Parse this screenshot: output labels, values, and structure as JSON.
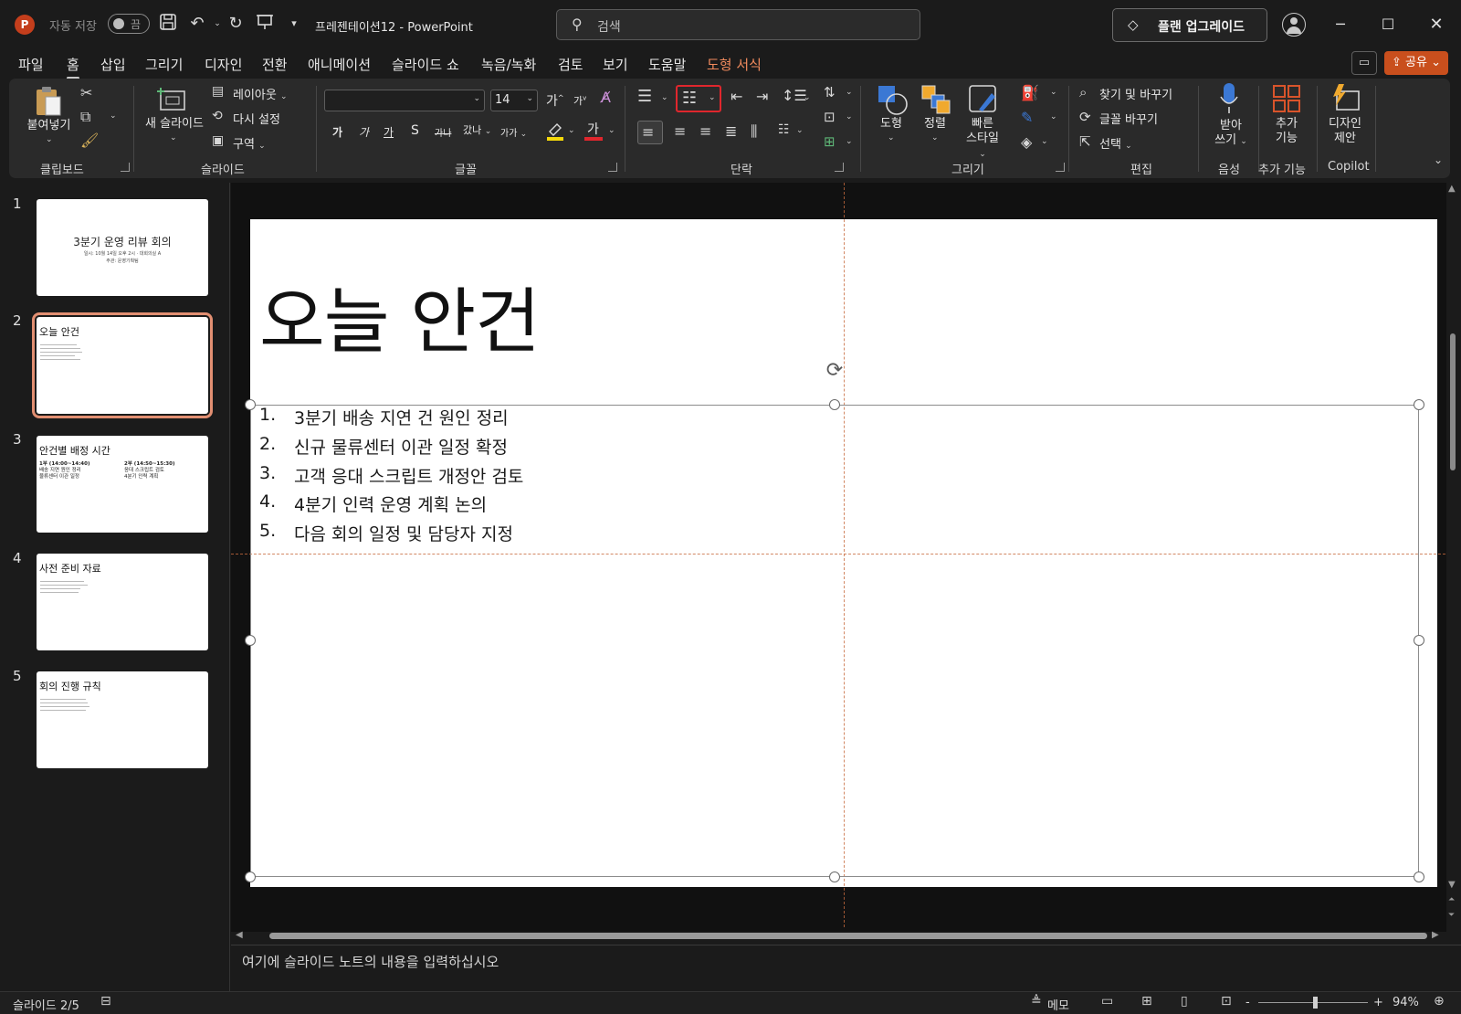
{
  "titlebar": {
    "app_letter": "P",
    "autosave_label": "자동 저장",
    "autosave_state": "끔",
    "doc_title": "프레젠테이션12  -  PowerPoint",
    "search_placeholder": "검색",
    "upgrade_label": "플랜 업그레이드",
    "icons": [
      "save-icon",
      "undo-icon",
      "redo-icon",
      "start-slideshow-icon",
      "customize-quick-access-icon"
    ]
  },
  "menu": {
    "tabs": [
      "파일",
      "홈",
      "삽입",
      "그리기",
      "디자인",
      "전환",
      "애니메이션",
      "슬라이드 쇼",
      "녹음/녹화",
      "검토",
      "보기",
      "도움말",
      "도형 서식"
    ],
    "active_tab": "홈",
    "accent_tab": "도형 서식",
    "share_label": "공유"
  },
  "ribbon": {
    "clipboard": {
      "label": "클립보드",
      "paste": "붙여넣기"
    },
    "slides": {
      "label": "슬라이드",
      "new_slide": "새 슬라이드",
      "layout": "레이아웃",
      "reset": "다시 설정",
      "section": "구역"
    },
    "font": {
      "label": "글꼴",
      "font_name": "",
      "font_size": "14",
      "grow": "가",
      "shrink": "가",
      "bold": "가",
      "italic": "가",
      "underline": "가",
      "shadow": "S",
      "strike": "가나",
      "spacing": "갔나",
      "case": "가가",
      "font_color_letter": "가"
    },
    "paragraph": {
      "label": "단락"
    },
    "drawing": {
      "label": "그리기",
      "shape": "도형",
      "arrange": "정렬",
      "quick_styles": [
        "빠른",
        "스타일"
      ]
    },
    "editing": {
      "label": "편집",
      "find_replace": "찾기 및 바꾸기",
      "replace_font": "글꼴 바꾸기",
      "select": "선택"
    },
    "voice": {
      "label": "음성",
      "dictate": [
        "받아",
        "쓰기"
      ]
    },
    "addins": {
      "label": "추가 기능",
      "button": [
        "추가",
        "기능"
      ]
    },
    "copilot": {
      "label": "Copilot",
      "designer": [
        "디자인",
        "제안"
      ]
    },
    "colors": {
      "highlight": "#f5d90a",
      "font_color": "#e0262d",
      "addins": "#d9542b",
      "designer": "#f0a92e"
    }
  },
  "thumbnails": [
    {
      "num": "1",
      "title": "3분기 운영 리뷰 회의",
      "sub1": "일시: 10월 14일 오후 2시 · 대회의실 A",
      "sub2": "주관: 운영기획팀"
    },
    {
      "num": "2",
      "title": "오늘 안건"
    },
    {
      "num": "3",
      "title": "안건별 배정 시간",
      "col1": [
        "1부 (14:00~14:40)",
        "배송 지연 원인 정리",
        "물류센터 이관 일정"
      ],
      "col2": [
        "2부 (14:50~15:30)",
        "응대 스크립트 검토",
        "4분기 인력 계획"
      ]
    },
    {
      "num": "4",
      "title": "사전 준비 자료"
    },
    {
      "num": "5",
      "title": "회의 진행 규칙"
    }
  ],
  "slide": {
    "title": "오늘 안건",
    "items": [
      {
        "num": "1.",
        "text": "3분기 배송 지연 건 원인 정리"
      },
      {
        "num": "2.",
        "text": "신규 물류센터 이관 일정 확정"
      },
      {
        "num": "3.",
        "text": "고객 응대 스크립트 개정안 검토"
      },
      {
        "num": "4.",
        "text": "4분기 인력 운영 계획 논의"
      },
      {
        "num": "5.",
        "text": "다음 회의 일정 및 담당자 지정"
      }
    ]
  },
  "notes": {
    "placeholder": "여기에 슬라이드 노트의 내용을 입력하십시오"
  },
  "status": {
    "slide_indicator": "슬라이드 2/5",
    "notes_label": "메모",
    "zoom": "94%",
    "zoom_minus": "-",
    "zoom_plus": "+"
  }
}
